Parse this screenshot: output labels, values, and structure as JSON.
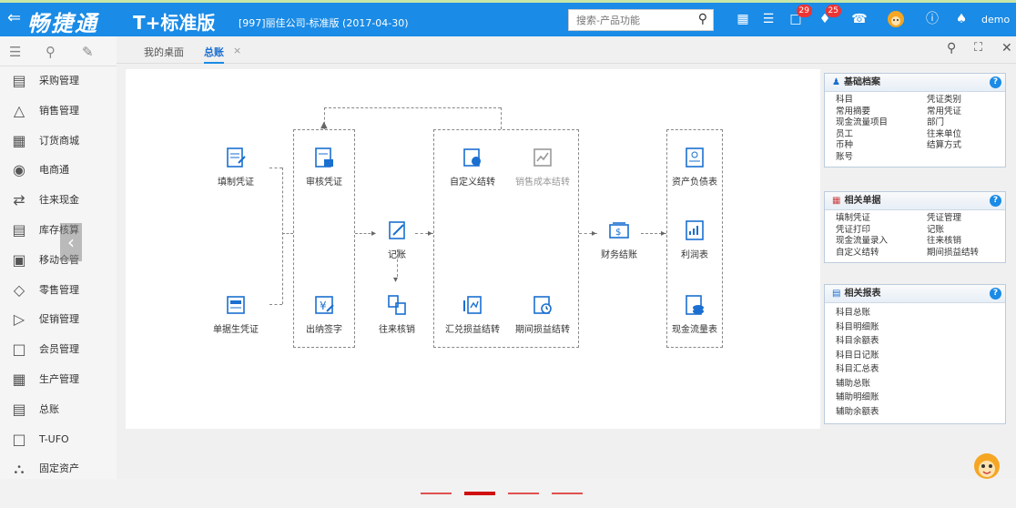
{
  "header": {
    "back_glyph": "⇐",
    "brand": "畅捷通",
    "product": "T+标准版",
    "company": "[997]丽佳公司-标准版  (2017-04-30)",
    "search_placeholder": "搜索-产品功能",
    "badge1": "29",
    "badge2": "25",
    "user": "demo"
  },
  "sidebar": {
    "items": [
      {
        "label": "采购管理",
        "icon": "cart-icon"
      },
      {
        "label": "销售管理",
        "icon": "chart-up-icon"
      },
      {
        "label": "订货商城",
        "icon": "store-icon"
      },
      {
        "label": "电商通",
        "icon": "ecommerce-icon"
      },
      {
        "label": "往来现金",
        "icon": "exchange-icon"
      },
      {
        "label": "库存核算",
        "icon": "warehouse-icon"
      },
      {
        "label": "移动仓管",
        "icon": "mobile-warehouse-icon"
      },
      {
        "label": "零售管理",
        "icon": "retail-icon"
      },
      {
        "label": "促销管理",
        "icon": "promotion-icon"
      },
      {
        "label": "会员管理",
        "icon": "member-icon"
      },
      {
        "label": "生产管理",
        "icon": "production-icon"
      },
      {
        "label": "总账",
        "icon": "ledger-icon"
      },
      {
        "label": "T-UFO",
        "icon": "ufo-icon"
      },
      {
        "label": "固定资产",
        "icon": "bank-icon"
      }
    ]
  },
  "tabs": {
    "home": "我的桌面",
    "active": "总账",
    "close": "×"
  },
  "flow": {
    "fill_voucher": "填制凭证",
    "review_voucher": "审核凭证",
    "bill_voucher": "单据生凭证",
    "cashier_sign": "出纳签字",
    "post": "记账",
    "ar_ap_verify": "往来核销",
    "custom_transfer": "自定义结转",
    "sales_cost_transfer": "销售成本结转",
    "fx_gain_transfer": "汇兑损益结转",
    "period_gain_transfer": "期间损益结转",
    "financial_close": "财务结账",
    "balance_sheet": "资产负债表",
    "income_statement": "利润表",
    "cashflow_statement": "现金流量表"
  },
  "panels": {
    "basic": {
      "title": "基础档案",
      "items": [
        "科目",
        "凭证类别",
        "常用摘要",
        "常用凭证",
        "现金流量项目",
        "部门",
        "员工",
        "往来单位",
        "币种",
        "结算方式",
        "账号",
        ""
      ]
    },
    "docs": {
      "title": "相关单据",
      "items": [
        "填制凭证",
        "凭证管理",
        "凭证打印",
        "记账",
        "现金流量录入",
        "往来核销",
        "自定义结转",
        "期间损益结转"
      ]
    },
    "reports": {
      "title": "相关报表",
      "items": [
        "科目总账",
        "科目明细账",
        "科目余额表",
        "科目日记账",
        "科目汇总表",
        "辅助总账",
        "辅助明细账",
        "辅助余额表"
      ]
    }
  },
  "colors": {
    "header": "#1a8be6",
    "accent": "#1a6fd0",
    "badge": "#e33333",
    "pager": "#d01010"
  }
}
